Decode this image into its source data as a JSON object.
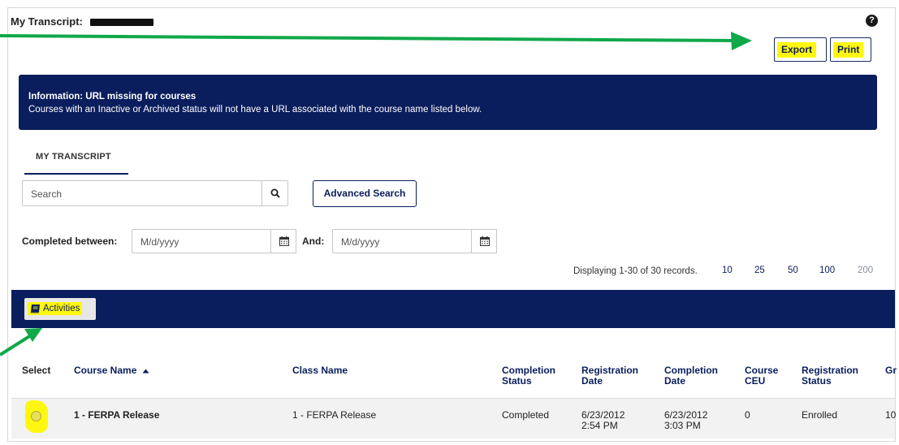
{
  "page": {
    "title_prefix": "My Transcript:"
  },
  "toolbar": {
    "export_label": "Export",
    "print_label": "Print"
  },
  "info": {
    "title": "Information: URL missing for courses",
    "message": "Courses with an Inactive or Archived status will not have a URL associated with the course name listed below."
  },
  "tabs": {
    "my_transcript": "MY TRANSCRIPT"
  },
  "search": {
    "placeholder": "Search",
    "advanced_label": "Advanced Search"
  },
  "date_filter": {
    "completed_between_label": "Completed between:",
    "and_label": "And:",
    "from_placeholder": "M/d/yyyy",
    "to_placeholder": "M/d/yyyy"
  },
  "pagination": {
    "records_text": "Displaying 1-30 of 30 records.",
    "page_sizes": [
      "10",
      "25",
      "50",
      "100",
      "200"
    ],
    "selected_size": "200"
  },
  "activities": {
    "label": "Activities"
  },
  "table": {
    "headers": {
      "select": "Select",
      "course_name": "Course Name",
      "class_name": "Class Name",
      "completion_status": "Completion Status",
      "registration_date": "Registration Date",
      "completion_date": "Completion Date",
      "course_ceu": "Course CEU",
      "registration_status": "Registration Status",
      "grade": "Gr"
    },
    "sort": {
      "column": "course_name",
      "direction": "ascending"
    },
    "rows": [
      {
        "course_name": "1 - FERPA Release",
        "class_name": "1 - FERPA Release",
        "completion_status": "Completed",
        "registration_date": "6/23/2012",
        "registration_time": "2:54 PM",
        "completion_date": "6/23/2012",
        "completion_time": "3:03 PM",
        "course_ceu": "0",
        "registration_status": "Enrolled",
        "grade": "10"
      }
    ]
  },
  "colors": {
    "navy": "#0a1d5c",
    "highlight": "#fff70f",
    "annotation_arrow": "#11a84a"
  },
  "icons": {
    "help": "question-circle-icon",
    "search": "magnifier-icon",
    "calendar": "calendar-icon",
    "activities": "book-icon",
    "sort": "caret-up-icon"
  }
}
